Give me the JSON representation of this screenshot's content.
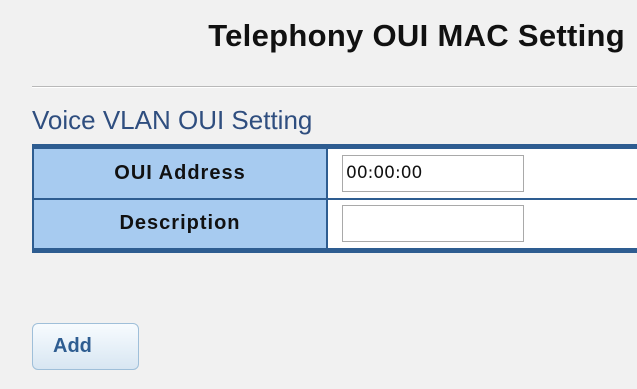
{
  "page": {
    "title": "Telephony OUI MAC Setting"
  },
  "section": {
    "title": "Voice VLAN OUI Setting"
  },
  "form": {
    "oui_address": {
      "label": "OUI Address",
      "value": "00:00:00"
    },
    "description": {
      "label": "Description",
      "value": ""
    }
  },
  "actions": {
    "add_label": "Add"
  },
  "colors": {
    "label_background": "#a7cbf0",
    "table_border": "#2e5d91",
    "section_title": "#2f4e7f",
    "page_background": "#f1f1f1"
  }
}
